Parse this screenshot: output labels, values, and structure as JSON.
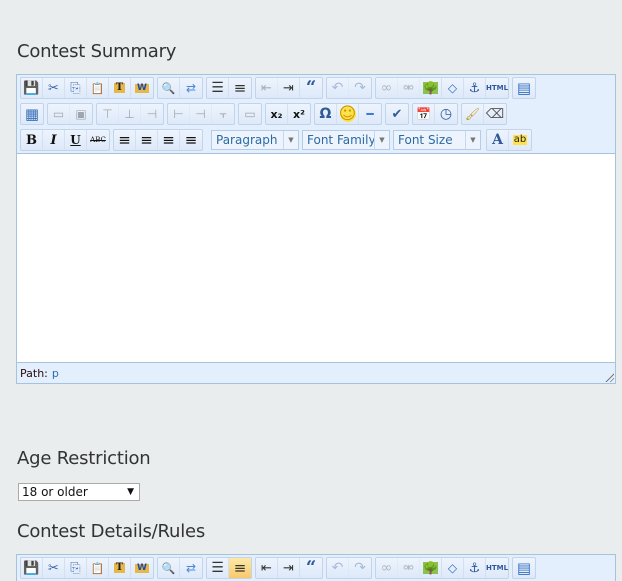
{
  "fields": {
    "contest_summary": {
      "label": "Contest Summary"
    },
    "age_restriction": {
      "label": "Age Restriction",
      "selected": "18 or older"
    },
    "contest_details": {
      "label": "Contest Details/Rules"
    }
  },
  "editor": {
    "row1": [
      {
        "group": [
          {
            "icon": "save-icon",
            "glyph": "💾",
            "title": "Save"
          },
          {
            "icon": "cut-icon",
            "glyph": "✂",
            "title": "Cut"
          },
          {
            "icon": "copy-icon",
            "glyph": "⎘",
            "title": "Copy"
          },
          {
            "icon": "paste-icon",
            "glyph": "📋",
            "title": "Paste"
          },
          {
            "icon": "paste-text-icon",
            "glyph": "T",
            "title": "Paste as Plain Text"
          },
          {
            "icon": "paste-word-icon",
            "glyph": "W",
            "title": "Paste from Word"
          }
        ]
      },
      {
        "group": [
          {
            "icon": "find-icon",
            "glyph": "🔍",
            "title": "Find"
          },
          {
            "icon": "replace-icon",
            "glyph": "⇄",
            "title": "Find and Replace"
          }
        ]
      },
      {
        "group": [
          {
            "icon": "bullet-list-icon",
            "glyph": "☰",
            "title": "Unordered list"
          },
          {
            "icon": "numbered-list-icon",
            "glyph": "≡",
            "title": "Ordered list"
          }
        ]
      },
      {
        "group": [
          {
            "icon": "outdent-icon",
            "glyph": "⇤",
            "title": "Outdent",
            "disabled": true
          },
          {
            "icon": "indent-icon",
            "glyph": "⇥",
            "title": "Indent"
          },
          {
            "icon": "blockquote-icon",
            "glyph": "“",
            "title": "Blockquote"
          }
        ]
      },
      {
        "group": [
          {
            "icon": "undo-icon",
            "glyph": "↶",
            "title": "Undo",
            "disabled": true
          },
          {
            "icon": "redo-icon",
            "glyph": "↷",
            "title": "Redo",
            "disabled": true
          }
        ]
      },
      {
        "group": [
          {
            "icon": "link-icon",
            "glyph": "∞",
            "title": "Insert/edit link",
            "disabled": true
          },
          {
            "icon": "unlink-icon",
            "glyph": "⚮",
            "title": "Unlink",
            "disabled": true
          },
          {
            "icon": "image-icon",
            "glyph": "🌳",
            "title": "Insert/edit image"
          },
          {
            "icon": "code-icon",
            "glyph": "◇",
            "title": "Cleanup messy code"
          },
          {
            "icon": "anchor-icon",
            "glyph": "⚓",
            "title": "Insert/edit anchor"
          },
          {
            "icon": "html-icon",
            "glyph": "HTML",
            "title": "Edit HTML Source"
          }
        ]
      },
      {
        "group": [
          {
            "icon": "fullscreen-icon",
            "glyph": "▤",
            "title": "Toggle fullscreen mode"
          }
        ]
      }
    ],
    "row2": [
      {
        "group": [
          {
            "icon": "table-icon",
            "glyph": "▦",
            "title": "Insert/edit table"
          }
        ]
      },
      {
        "group": [
          {
            "icon": "row-props-icon",
            "glyph": "▭",
            "title": "Table row properties",
            "disabled": true
          },
          {
            "icon": "cell-props-icon",
            "glyph": "▣",
            "title": "Table cell properties",
            "disabled": true
          }
        ]
      },
      {
        "group": [
          {
            "icon": "row-before-icon",
            "glyph": "⊤",
            "title": "Insert row before",
            "disabled": true
          },
          {
            "icon": "row-after-icon",
            "glyph": "⊥",
            "title": "Insert row after",
            "disabled": true
          },
          {
            "icon": "delete-row-icon",
            "glyph": "⊣",
            "title": "Delete row",
            "disabled": true
          }
        ]
      },
      {
        "group": [
          {
            "icon": "col-before-icon",
            "glyph": "⊢",
            "title": "Insert column before",
            "disabled": true
          },
          {
            "icon": "col-after-icon",
            "glyph": "⊣",
            "title": "Insert column after",
            "disabled": true
          },
          {
            "icon": "delete-col-icon",
            "glyph": "⫟",
            "title": "Delete column",
            "disabled": true
          }
        ]
      },
      {
        "group": [
          {
            "icon": "merge-cells-icon",
            "glyph": "▭",
            "title": "Merge table cells",
            "disabled": true
          }
        ]
      },
      {
        "group": [
          {
            "icon": "subscript-icon",
            "glyph": "x₂",
            "title": "Subscript"
          },
          {
            "icon": "superscript-icon",
            "glyph": "x²",
            "title": "Superscript"
          }
        ]
      },
      {
        "group": [
          {
            "icon": "special-char-icon",
            "glyph": "Ω",
            "title": "Insert custom character"
          },
          {
            "icon": "emoticon-icon",
            "glyph": "☺",
            "title": "Insert emotion"
          },
          {
            "icon": "hr-icon",
            "glyph": "━",
            "title": "Insert horizontal ruler"
          }
        ]
      },
      {
        "group": [
          {
            "icon": "spellcheck-icon",
            "glyph": "✔",
            "title": "Toggle spellchecker"
          }
        ]
      },
      {
        "group": [
          {
            "icon": "insert-date-icon",
            "glyph": "📅",
            "title": "Insert date"
          },
          {
            "icon": "insert-time-icon",
            "glyph": "◷",
            "title": "Insert time"
          }
        ]
      },
      {
        "group": [
          {
            "icon": "cleanup-icon",
            "glyph": "🖌",
            "title": "Cleanup"
          },
          {
            "icon": "remove-format-icon",
            "glyph": "⌫",
            "title": "Remove formatting"
          }
        ]
      }
    ],
    "row3": {
      "format_buttons": [
        {
          "icon": "bold-icon",
          "glyph": "B",
          "title": "Bold"
        },
        {
          "icon": "italic-icon",
          "glyph": "I",
          "title": "Italic"
        },
        {
          "icon": "underline-icon",
          "glyph": "U",
          "title": "Underline"
        },
        {
          "icon": "strikethrough-icon",
          "glyph": "ABC",
          "title": "Strikethrough"
        }
      ],
      "align_buttons": [
        {
          "icon": "align-left-icon",
          "glyph": "≡",
          "title": "Align left"
        },
        {
          "icon": "align-center-icon",
          "glyph": "≡",
          "title": "Align center"
        },
        {
          "icon": "align-right-icon",
          "glyph": "≡",
          "title": "Align right"
        },
        {
          "icon": "align-justify-icon",
          "glyph": "≡",
          "title": "Align full"
        }
      ],
      "format_select": "Paragraph",
      "font_family_select": "Font Family",
      "font_size_select": "Font Size",
      "color_buttons": [
        {
          "icon": "text-color-icon",
          "glyph": "A",
          "title": "Select text color"
        },
        {
          "icon": "highlight-color-icon",
          "glyph": "ab",
          "title": "Select background color"
        }
      ]
    },
    "status": {
      "path_label": "Path:",
      "path_value": "p"
    }
  },
  "editor2_state": {
    "active_button": "numbered-list-icon",
    "outdent_enabled": true
  },
  "colors": {
    "page_bg": "#e9eded",
    "toolbar_bg": "#e4effd",
    "border": "#a6c2dc",
    "listbox_text": "#2c6aa3",
    "path_value": "#2b6ab1",
    "active_button": "#f9c96a"
  }
}
